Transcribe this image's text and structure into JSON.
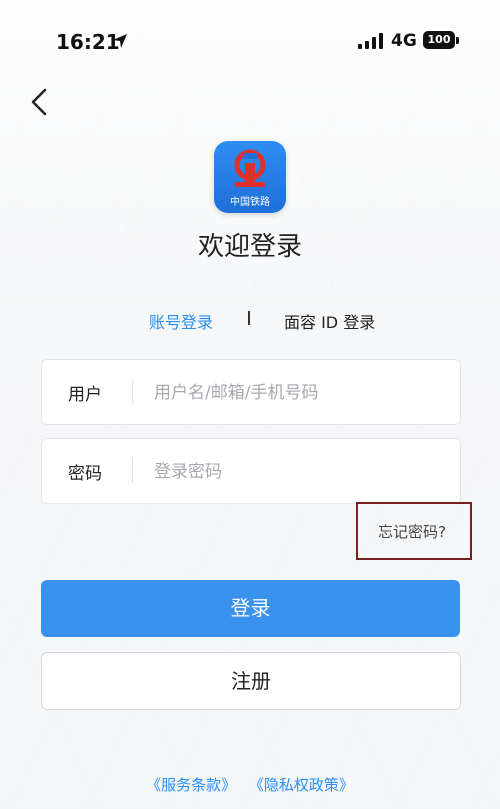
{
  "status_bar": {
    "time": "16:21",
    "network": "4G",
    "battery": "100"
  },
  "app": {
    "logo_text": "中国铁路",
    "welcome": "欢迎登录"
  },
  "tabs": {
    "account": "账号登录",
    "face_id": "面容 ID 登录"
  },
  "form": {
    "user_label": "用户",
    "user_placeholder": "用户名/邮箱/手机号码",
    "password_label": "密码",
    "password_placeholder": "登录密码",
    "forgot": "忘记密码?"
  },
  "buttons": {
    "login": "登录",
    "register": "注册"
  },
  "footer": {
    "terms": "《服务条款》",
    "privacy": "《隐私权政策》"
  },
  "colors": {
    "accent": "#3a92ef",
    "link": "#2a8ff2",
    "logo": "#1e6fd8"
  },
  "icons": {
    "back": "chevron-left-icon",
    "location": "location-arrow-icon",
    "signal": "cellular-signal-icon"
  }
}
